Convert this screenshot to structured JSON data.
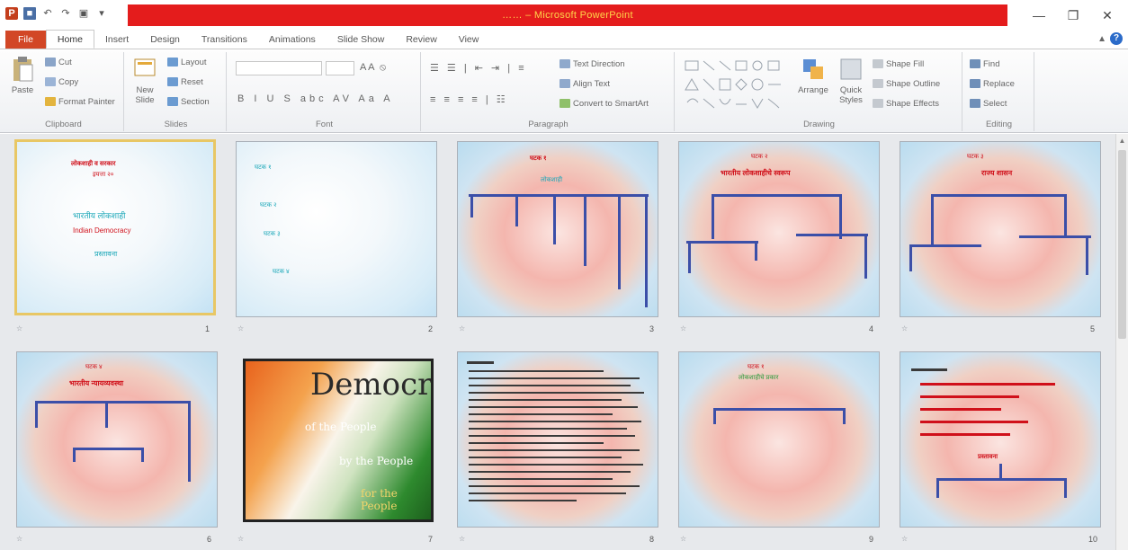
{
  "window": {
    "title": "…… – Microsoft PowerPoint",
    "controls": [
      "—",
      "❐",
      "✕"
    ]
  },
  "tabs": [
    {
      "label": "File"
    },
    {
      "label": "Home"
    },
    {
      "label": "Insert"
    },
    {
      "label": "Design"
    },
    {
      "label": "Transitions"
    },
    {
      "label": "Animations"
    },
    {
      "label": "Slide Show"
    },
    {
      "label": "Review"
    },
    {
      "label": "View"
    }
  ],
  "ribbon": {
    "clipboard": {
      "label": "Clipboard",
      "paste": "Paste",
      "cut": "Cut",
      "copy": "Copy",
      "format_painter": "Format Painter"
    },
    "slides": {
      "label": "Slides",
      "new_slide": "New Slide",
      "layout": "Layout",
      "reset": "Reset",
      "section": "Section"
    },
    "font": {
      "label": "Font"
    },
    "paragraph": {
      "label": "Paragraph",
      "text_direction": "Text Direction",
      "align_text": "Align Text",
      "convert": "Convert to SmartArt"
    },
    "drawing": {
      "label": "Drawing",
      "arrange": "Arrange",
      "quick_styles": "Quick Styles",
      "shape_fill": "Shape Fill",
      "shape_outline": "Shape Outline",
      "shape_effects": "Shape Effects"
    },
    "editing": {
      "label": "Editing",
      "find": "Find",
      "replace": "Replace",
      "select": "Select"
    }
  },
  "slides": [
    {
      "number": "1",
      "texts": [
        "लोकशाही व सरकार",
        "इयत्ता २०",
        "भारतीय लोकशाही",
        "Indian Democracy",
        "प्रस्तावना"
      ]
    },
    {
      "number": "2",
      "texts": [
        "घटक १",
        "घटक २",
        "घटक ३",
        "घटक ४"
      ]
    },
    {
      "number": "3",
      "texts": [
        "घटक १",
        "लोकशाही"
      ]
    },
    {
      "number": "4",
      "texts": [
        "घटक २",
        "भारतीय लोकशाहीचे स्वरूप"
      ]
    },
    {
      "number": "5",
      "texts": [
        "घटक ३",
        "राज्य शासन"
      ]
    },
    {
      "number": "6",
      "texts": [
        "घटक ४",
        "भारतीय न्यायव्यवस्था"
      ]
    },
    {
      "number": "7",
      "texts": [
        "Democracy",
        "of the People",
        "by the People",
        "for the People"
      ]
    },
    {
      "number": "8",
      "texts": []
    },
    {
      "number": "9",
      "texts": [
        "घटक १",
        "लोकशाहीचे प्रकार"
      ]
    },
    {
      "number": "10",
      "texts": [
        "प्रस्तावना"
      ]
    }
  ]
}
